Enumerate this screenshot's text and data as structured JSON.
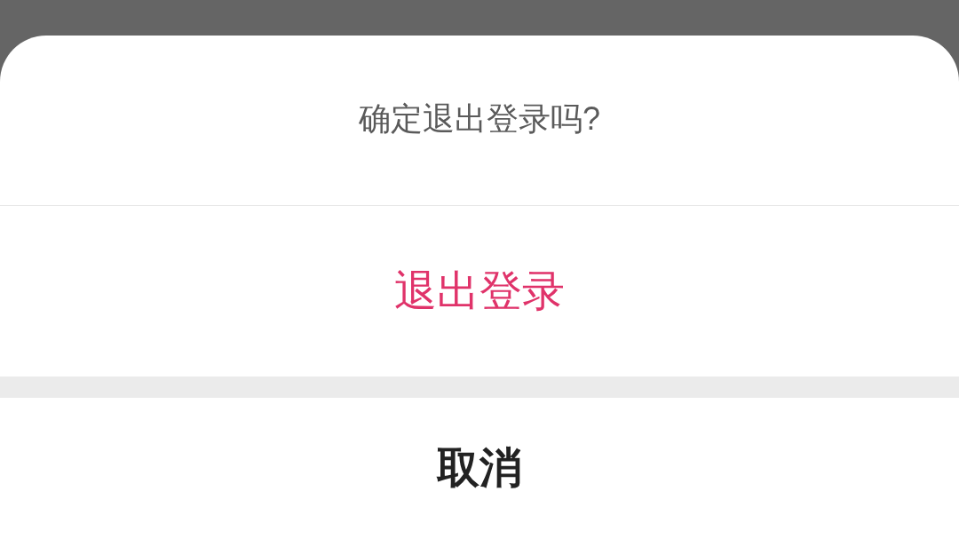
{
  "dialog": {
    "message": "确定退出登录吗?",
    "actions": [
      {
        "label": "退出登录",
        "kind": "destructive"
      },
      {
        "label": "取消",
        "kind": "cancel"
      }
    ]
  }
}
